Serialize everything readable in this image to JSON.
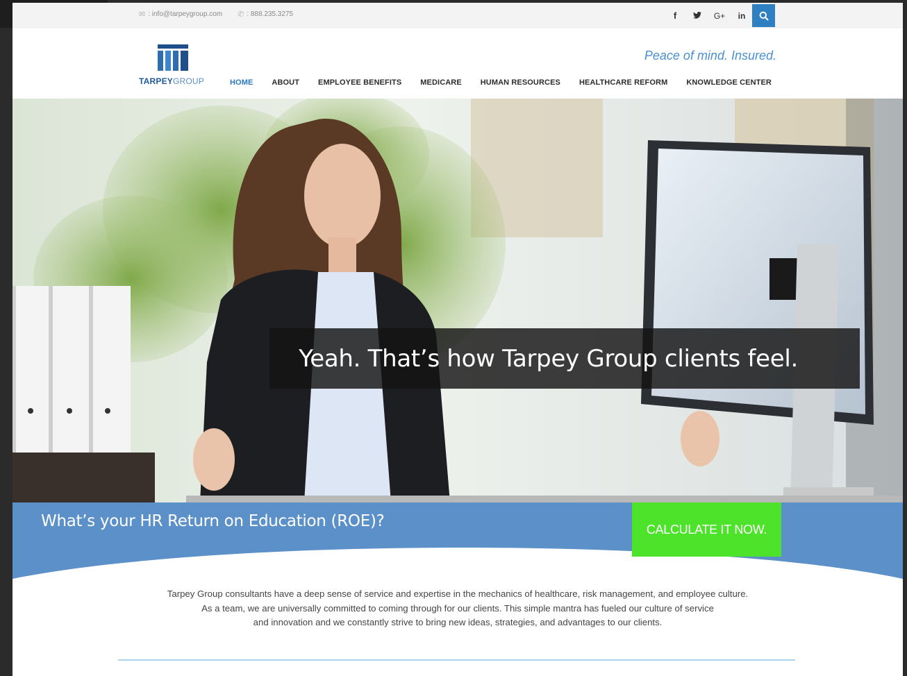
{
  "topbar": {
    "email": ": info@tarpeygroup.com",
    "phone": ": 888.235.3275",
    "social": [
      {
        "icon": "facebook-icon",
        "glyph": "f"
      },
      {
        "icon": "twitter-icon",
        "glyph": "❧"
      },
      {
        "icon": "google-plus-icon",
        "glyph": "G+"
      },
      {
        "icon": "linkedin-icon",
        "glyph": "in"
      }
    ],
    "search_icon": "search-icon"
  },
  "header": {
    "logo_bold": "TARPEY",
    "logo_light": "GROUP",
    "tagline": "Peace of mind. Insured."
  },
  "nav": {
    "items": [
      {
        "label": "HOME",
        "active": true
      },
      {
        "label": "ABOUT",
        "active": false
      },
      {
        "label": "EMPLOYEE BENEFITS",
        "active": false
      },
      {
        "label": "MEDICARE",
        "active": false
      },
      {
        "label": "HUMAN RESOURCES",
        "active": false
      },
      {
        "label": "HEALTHCARE REFORM",
        "active": false
      },
      {
        "label": "KNOWLEDGE CENTER",
        "active": false
      }
    ]
  },
  "hero": {
    "caption": "Yeah. That’s how Tarpey Group clients feel."
  },
  "roe": {
    "question": "What’s your HR Return on Education (ROE)?",
    "cta": "CALCULATE IT NOW."
  },
  "about": {
    "line1": "Tarpey Group consultants have a deep sense of service and expertise in the mechanics of healthcare, risk management, and employee culture.",
    "line2": "As a team, we are universally committed to coming through for our clients. This simple mantra has fueled our culture of service",
    "line3": "and innovation and we constantly strive to bring new ideas, strategies, and advantages to our clients."
  },
  "colors": {
    "brand_blue": "#2e80c3",
    "band_blue": "#5b90c8",
    "cta_green": "#4ee32b",
    "tagline_blue": "#4a8fd0"
  }
}
